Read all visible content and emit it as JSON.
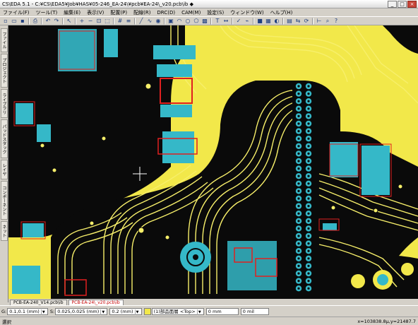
{
  "window": {
    "title": "CS\\EDA 5.1 - C:¥CS\\EDA5¥Job¥HAS¥05-246_EA-24\\¥pcb¥EA-24\\_v20.pcb\\ib ◆",
    "buttons": [
      "_",
      "□",
      "×"
    ]
  },
  "menu": [
    "ファイル(F)",
    "ツール(T)",
    "編集(E)",
    "表示(V)",
    "配置(P)",
    "配線(R)",
    "DRC(D)",
    "CAM(M)",
    "設定(S)",
    "ウィンドウ(W)",
    "ヘルプ(H)"
  ],
  "toolbar": {
    "icons": [
      "new-icon",
      "open-icon",
      "save-icon",
      "sep",
      "print-icon",
      "sep",
      "undo-icon",
      "redo-icon",
      "sep",
      "pointer-icon",
      "sep",
      "zoom-in-icon",
      "zoom-out-icon",
      "zoom-fit-icon",
      "zoom-window-icon",
      "sep",
      "grid-icon",
      "layer-icon",
      "sep",
      "line-icon",
      "route-icon",
      "via-icon",
      "sep",
      "pad-icon",
      "arc-icon",
      "circle-icon",
      "poly-icon",
      "fill-icon",
      "sep",
      "text-icon",
      "dimension-icon",
      "sep",
      "drc-icon",
      "net-icon",
      "sep",
      "layer-color-icon",
      "copper-icon",
      "highlight-icon",
      "sep",
      "component-icon",
      "flip-icon",
      "rotate-icon",
      "sep",
      "measure-icon",
      "search-icon",
      "help-icon"
    ],
    "glyphs": [
      "▫",
      "▭",
      "▪",
      "|",
      "⎙",
      "|",
      "↶",
      "↷",
      "|",
      "↖",
      "|",
      "+",
      "−",
      "⊡",
      "⬚",
      "|",
      "#",
      "≡",
      "|",
      "╱",
      "∿",
      "◉",
      "|",
      "▣",
      "◠",
      "○",
      "⬠",
      "▩",
      "|",
      "T",
      "↔",
      "|",
      "✓",
      "⌁",
      "|",
      "■",
      "▦",
      "◐",
      "|",
      "▤",
      "⇆",
      "⟳",
      "|",
      "⊢",
      "⌕",
      "?"
    ]
  },
  "sidebar": {
    "tabs": [
      "ファイル",
      "プロジェクト",
      "ライブラリ",
      "パッドスタック",
      "レイヤ",
      "コンポーネント",
      "ネット"
    ]
  },
  "colors": {
    "board_fill": "#f2e84a",
    "copper_dark": "#0a0a0a",
    "trace": "#f7ef6a",
    "pad": "#35b8c8",
    "silk_red": "#e02020",
    "drill": "#f2e84a"
  },
  "doc_tabs": [
    {
      "label": "PCB-EA-240_V14.pcb\\ib",
      "active": false
    },
    {
      "label": "PCB-EA-24\\_v20.pcb\\ib",
      "active": true
    }
  ],
  "status": {
    "grid_label": "G:",
    "grid_value": "0.1,0.1 (mm)",
    "snap_label": "S:",
    "snap_value": "0.025,0.025 (mm)",
    "width_value": "0.2 (mm)",
    "layer_value": "(1)部品面層 <Top>",
    "x_value": "0 mm",
    "y_value": "0 mil"
  },
  "bottom": {
    "left": "選択",
    "coords": "x=103838.8μ,y=21487.7"
  }
}
